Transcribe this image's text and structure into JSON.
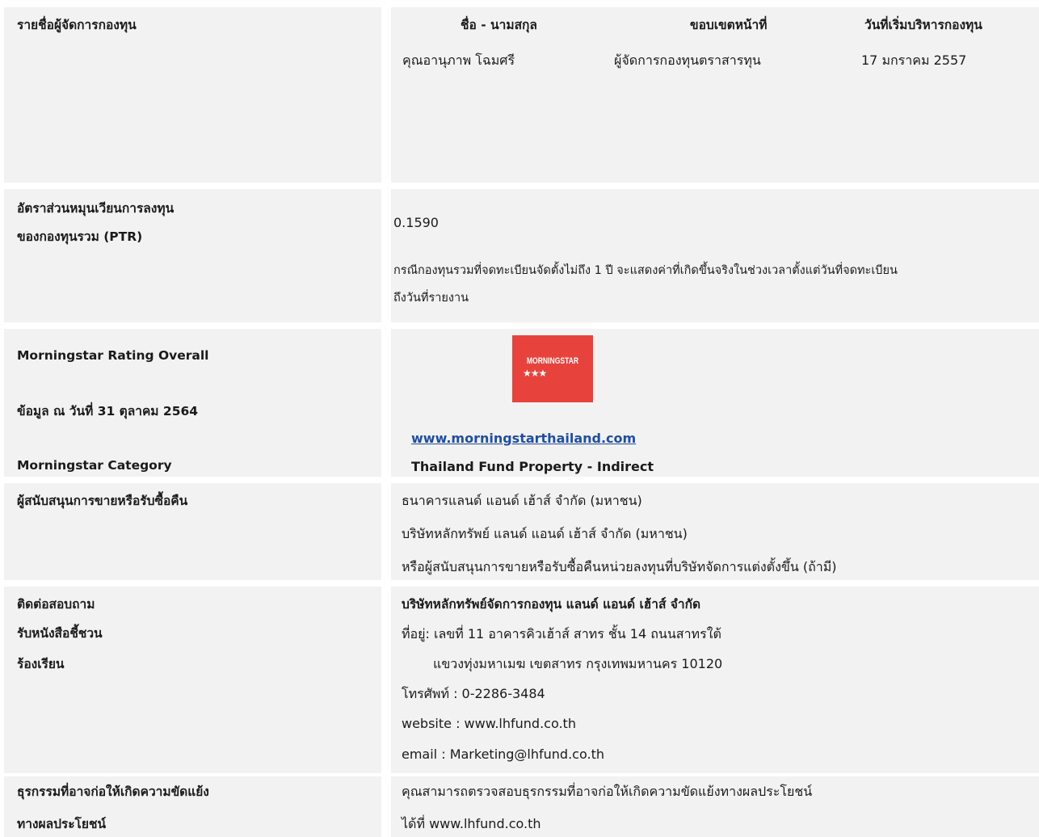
{
  "fund_manager": {
    "label": "รายชื่อผู้จัดการกองทุน",
    "headers": [
      "ชื่อ - นามสกุล",
      "ขอบเขตหน้าที่",
      "วันที่เริ่มบริหารกองทุน"
    ],
    "name": "คุณอานุภาพ โฉมศรี",
    "role": "ผู้จัดการกองทุนตราสารทุน",
    "start_date": "17 มกราคม 2557"
  },
  "ptr": {
    "label_line1": "อัตราส่วนหมุนเวียนการลงทุน",
    "label_line2": "ของกองทุนรวม (PTR)",
    "value": "0.1590",
    "note_line1": "กรณีกองทุนรวมที่จดทะเบียนจัดตั้งไม่ถึง 1 ปี จะแสดงค่าที่เกิดขึ้นจริงในช่วงเวลาตั้งแต่วันที่จดทะเบียน",
    "note_line2": "ถึงวันที่รายงาน"
  },
  "morningstar": {
    "label_rating": "Morningstar Rating Overall",
    "label_date": "ข้อมูล ณ วันที่ 31 ตุลาคม 2564",
    "label_category": "Morningstar Category",
    "logo_text": "MORNINGSTAR",
    "logo_stars": "★★★",
    "rating_stars": 3,
    "link": "www.morningstarthailand.com",
    "category": "Thailand Fund Property - Indirect",
    "logo_color": "#e8423c",
    "link_color": "#1f4ea3"
  },
  "distributors": {
    "label": "ผู้สนับสนุนการขายหรือรับซื้อคืน",
    "line1": "ธนาคารแลนด์ แอนด์ เฮ้าส์ จำกัด (มหาชน)",
    "line2": "บริษัทหลักทรัพย์ แลนด์ แอนด์ เฮ้าส์ จำกัด (มหาชน)",
    "line3": "หรือผู้สนับสนุนการขายหรือรับซื้อคืนหน่วยลงทุนที่บริษัทจัดการแต่งตั้งขึ้น (ถ้ามี)"
  },
  "contact": {
    "label_line1": "ติดต่อสอบถาม",
    "label_line2": "รับหนังสือชี้ชวน",
    "label_line3": "ร้องเรียน",
    "company": "บริษัทหลักทรัพย์จัดการกองทุน แลนด์ แอนด์ เฮ้าส์ จำกัด",
    "address1": "ที่อยู่: เลขที่ 11 อาคารคิวเฮ้าส์ สาทร ชั้น 14  ถนนสาทรใต้",
    "address2": "แขวงทุ่งมหาเมฆ  เขตสาทร กรุงเทพมหานคร  10120",
    "phone": "โทรศัพท์ : 0-2286-3484",
    "website": "website : www.lhfund.co.th",
    "email": "email : Marketing@lhfund.co.th"
  },
  "conflict": {
    "label_line1": "ธุรกรรมที่อาจก่อให้เกิดความขัดแย้ง",
    "label_line2": "ทางผลประโยชน์",
    "text_line1": "คุณสามารถตรวจสอบธุรกรรมที่อาจก่อให้เกิดความขัดแย้งทางผลประโยชน์",
    "text_line2": "ได้ที่ www.lhfund.co.th"
  },
  "colors": {
    "cell_background": "#f2f2f2",
    "text": "#1a1a1a"
  }
}
